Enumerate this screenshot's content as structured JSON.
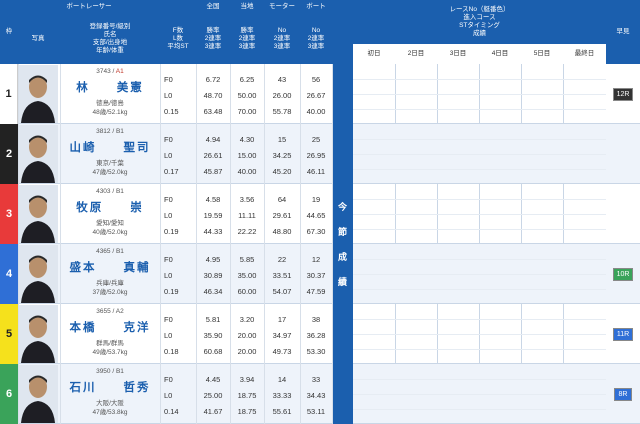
{
  "header": {
    "frame_label": "枠",
    "photo_label": "写真",
    "boat_racer": "ボートレーサー",
    "racer_info": [
      "登録番号/級別",
      "氏名",
      "支部/出身地",
      "年齢/体重"
    ],
    "flst": [
      "F数",
      "L数",
      "平均ST"
    ],
    "national": "全国",
    "local": "当地",
    "motor": "モーター",
    "boat": "ボート",
    "rate_rows": [
      "勝率",
      "2連率",
      "3連率"
    ],
    "no_rows": [
      "No",
      "2連率",
      "3連率"
    ],
    "race_info": [
      "レースNo（艇番色）",
      "進入コース",
      "STタイミング",
      "成績"
    ],
    "days": [
      "初日",
      "2日目",
      "3日目",
      "4日目",
      "5日目",
      "最終日"
    ],
    "early": "早見"
  },
  "middle_label": [
    "今",
    "節",
    "成",
    "績"
  ],
  "frame_colors": [
    "#ffffff",
    "#222222",
    "#e83a3a",
    "#2f6fd6",
    "#f5e11c",
    "#3aa35a"
  ],
  "frame_text_colors": [
    "#222222",
    "#ffffff",
    "#ffffff",
    "#ffffff",
    "#222222",
    "#ffffff"
  ],
  "racers": [
    {
      "frame": "1",
      "reg": "3743",
      "cls": "A1",
      "name": "林　　美憲",
      "branch": "徳島/徳島",
      "agewt": "48歳/52.1kg",
      "f": "F0",
      "l": "L0",
      "st": "0.15",
      "nat": [
        "6.72",
        "48.70",
        "63.48"
      ],
      "loc": [
        "6.25",
        "50.00",
        "70.00"
      ],
      "motor": [
        "43",
        "26.00",
        "55.78"
      ],
      "boat": [
        "56",
        "26.67",
        "40.00"
      ],
      "early": "12R",
      "early_color": "#333333"
    },
    {
      "frame": "2",
      "reg": "3812",
      "cls": "B1",
      "name": "山崎　　聖司",
      "branch": "東京/千葉",
      "agewt": "47歳/52.0kg",
      "f": "F0",
      "l": "L0",
      "st": "0.17",
      "nat": [
        "4.94",
        "26.61",
        "45.87"
      ],
      "loc": [
        "4.30",
        "15.00",
        "40.00"
      ],
      "motor": [
        "15",
        "34.25",
        "45.20"
      ],
      "boat": [
        "25",
        "26.95",
        "46.11"
      ],
      "early": "",
      "early_color": ""
    },
    {
      "frame": "3",
      "reg": "4303",
      "cls": "B1",
      "name": "牧原　　崇",
      "branch": "愛知/愛知",
      "agewt": "40歳/52.0kg",
      "f": "F0",
      "l": "L0",
      "st": "0.19",
      "nat": [
        "4.58",
        "19.59",
        "44.33"
      ],
      "loc": [
        "3.56",
        "11.11",
        "22.22"
      ],
      "motor": [
        "64",
        "29.61",
        "48.80"
      ],
      "boat": [
        "19",
        "44.65",
        "67.30"
      ],
      "early": "",
      "early_color": ""
    },
    {
      "frame": "4",
      "reg": "4365",
      "cls": "B1",
      "name": "盛本　　真輔",
      "branch": "兵庫/兵庫",
      "agewt": "37歳/52.0kg",
      "f": "F0",
      "l": "L0",
      "st": "0.19",
      "nat": [
        "4.95",
        "30.89",
        "46.34"
      ],
      "loc": [
        "5.85",
        "35.00",
        "60.00"
      ],
      "motor": [
        "22",
        "33.51",
        "54.07"
      ],
      "boat": [
        "12",
        "30.37",
        "47.59"
      ],
      "early": "10R",
      "early_color": "#3aa35a"
    },
    {
      "frame": "5",
      "reg": "3655",
      "cls": "A2",
      "name": "本橋　　克洋",
      "branch": "群馬/群馬",
      "agewt": "49歳/53.7kg",
      "f": "F0",
      "l": "L0",
      "st": "0.18",
      "nat": [
        "5.81",
        "35.90",
        "60.68"
      ],
      "loc": [
        "3.20",
        "20.00",
        "20.00"
      ],
      "motor": [
        "17",
        "34.97",
        "49.73"
      ],
      "boat": [
        "38",
        "36.28",
        "53.30"
      ],
      "early": "11R",
      "early_color": "#2f6fd6"
    },
    {
      "frame": "6",
      "reg": "3950",
      "cls": "B1",
      "name": "石川　　哲秀",
      "branch": "大阪/大阪",
      "agewt": "47歳/53.8kg",
      "f": "F0",
      "l": "L0",
      "st": "0.14",
      "nat": [
        "4.45",
        "25.00",
        "41.67"
      ],
      "loc": [
        "3.94",
        "18.75",
        "18.75"
      ],
      "motor": [
        "14",
        "33.33",
        "55.61"
      ],
      "boat": [
        "33",
        "34.43",
        "53.11"
      ],
      "early": "8R",
      "early_color": "#2f6fd6"
    }
  ]
}
